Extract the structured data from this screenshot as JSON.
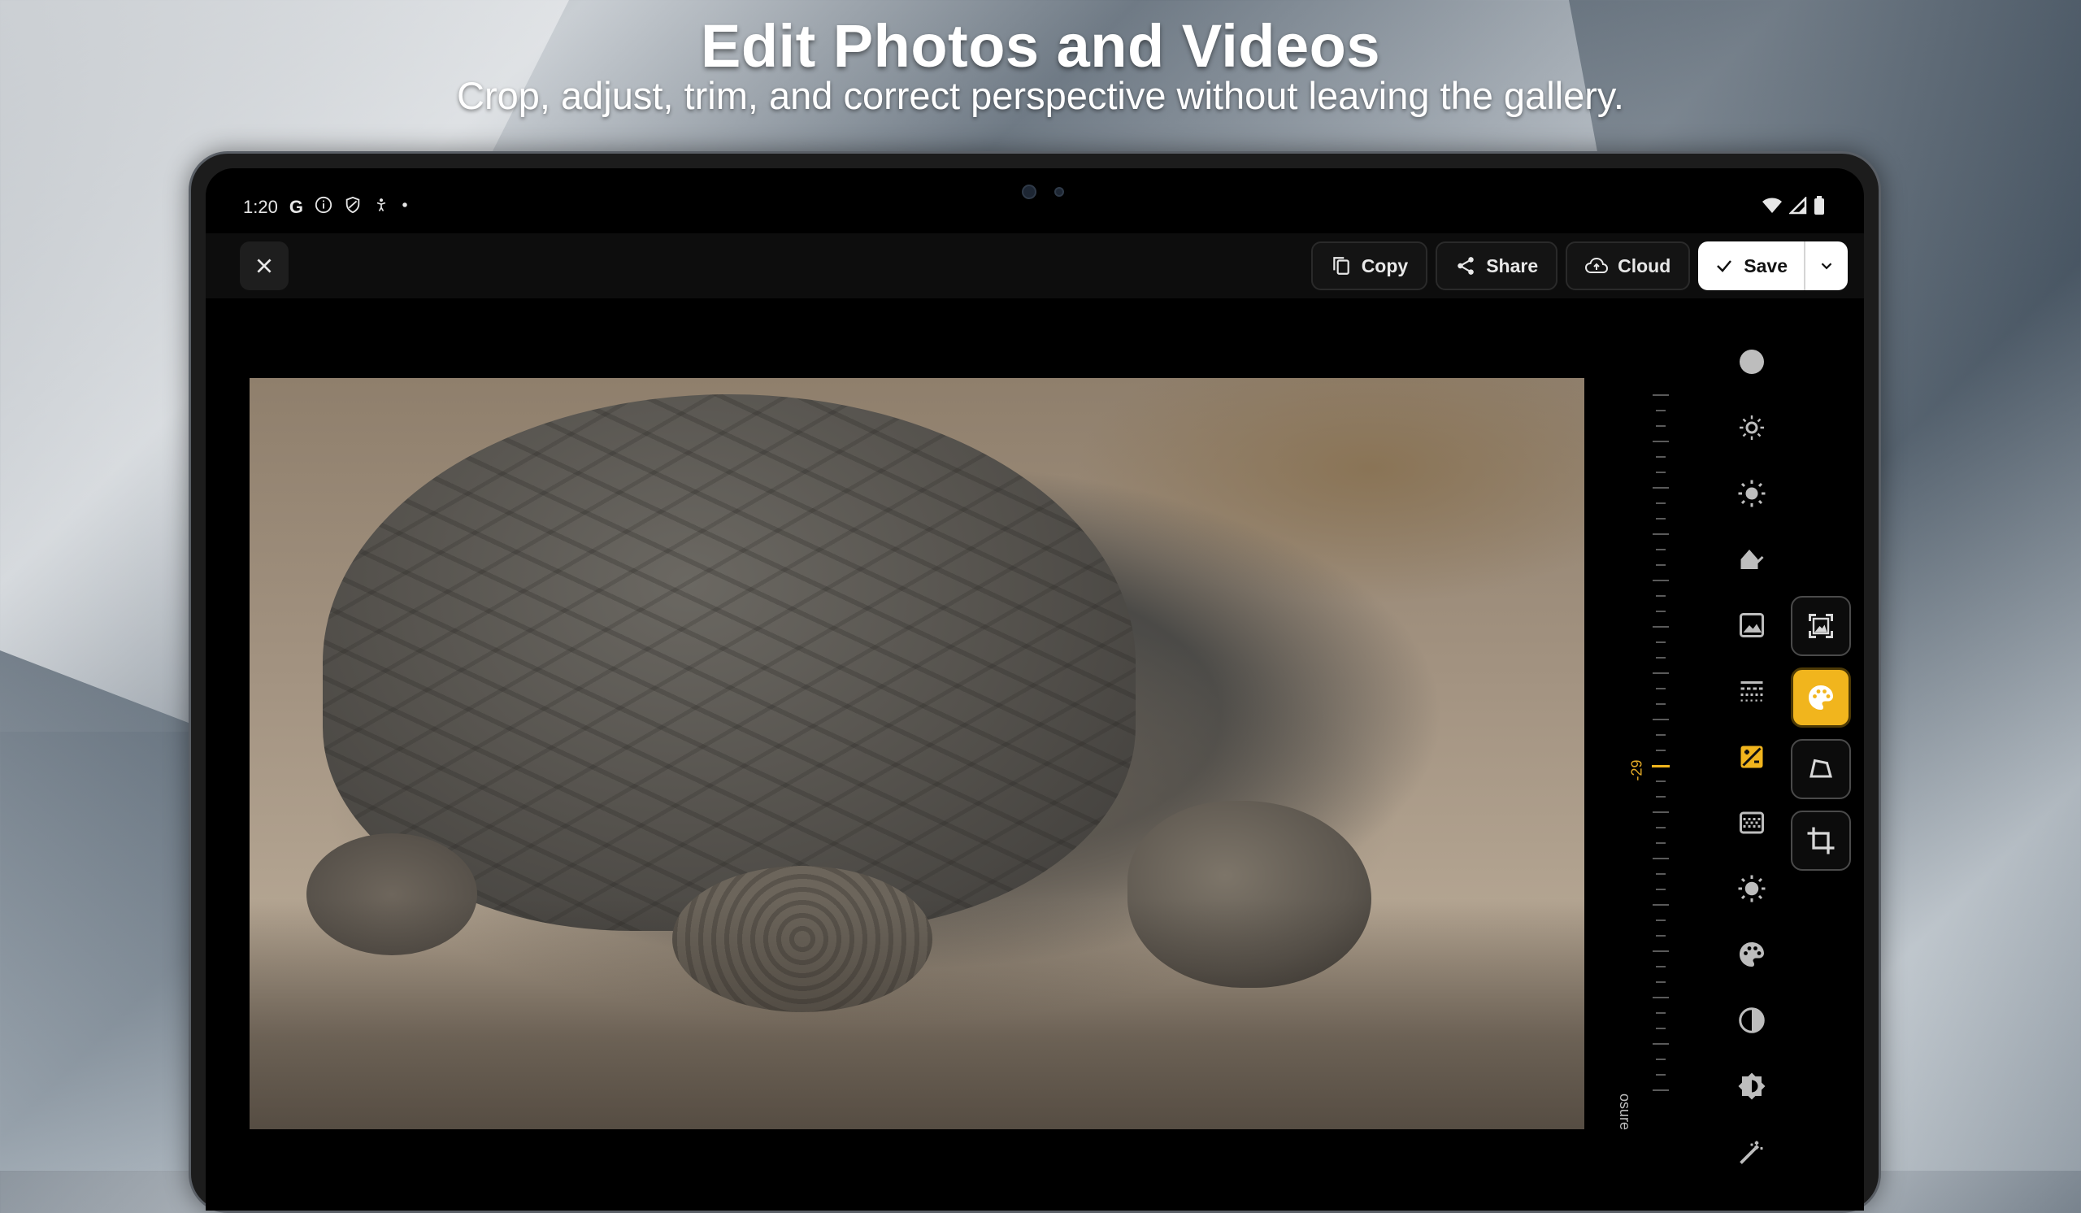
{
  "promo": {
    "title": "Edit Photos and Videos",
    "subtitle": "Crop, adjust, trim, and correct perspective without leaving the gallery."
  },
  "status_bar": {
    "time": "1:20",
    "left_icons": [
      "google-g-icon",
      "info-icon",
      "shield-icon",
      "accessibility-icon",
      "dot-icon"
    ],
    "right_icons": [
      "wifi-icon",
      "signal-icon",
      "battery-icon"
    ],
    "g_letter": "G"
  },
  "toolbar": {
    "copy_label": "Copy",
    "share_label": "Share",
    "cloud_label": "Cloud",
    "save_label": "Save"
  },
  "adjustment": {
    "name": "Exposure",
    "visible_label": "osure",
    "value": "-29"
  },
  "tools": [
    "circle-icon",
    "brightness-low-icon",
    "brightness-high-icon",
    "shadow-icon",
    "image-icon",
    "grain-icon",
    "exposure-icon",
    "texture-icon",
    "sun-icon",
    "palette-icon",
    "contrast-icon",
    "tonality-icon",
    "magic-wand-icon"
  ],
  "active_tool": "exposure-icon",
  "modes": [
    "frame-icon",
    "palette-icon",
    "perspective-icon",
    "crop-icon"
  ],
  "active_mode": "palette-icon",
  "colors": {
    "accent": "#f1b51d",
    "screen_bg": "#000000",
    "button_bg": "#141414",
    "save_bg": "#ffffff"
  }
}
